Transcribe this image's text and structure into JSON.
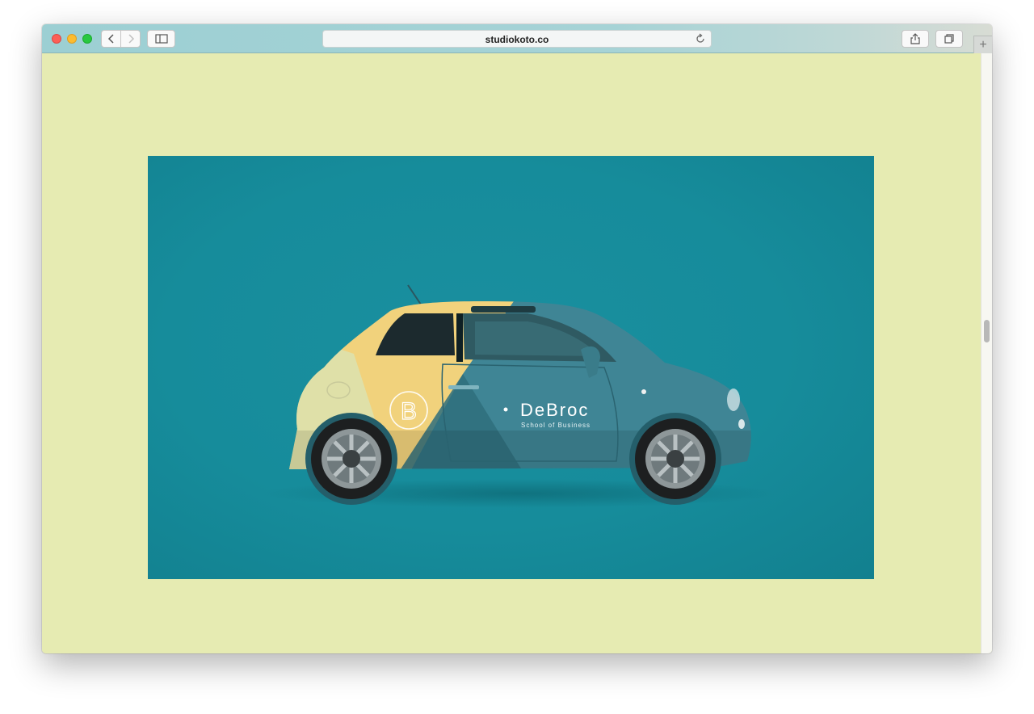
{
  "browser": {
    "url": "studiokoto.co"
  },
  "hero": {
    "brand_name": "DeBroc",
    "brand_tagline": "School of Business",
    "logo_letter": "B"
  },
  "colors": {
    "page_background": "#e6ebb2",
    "hero_background": "#168c9b",
    "car_body": "#3f8595",
    "car_yellow": "#f1d27c",
    "car_cream": "#dfe0a8"
  }
}
